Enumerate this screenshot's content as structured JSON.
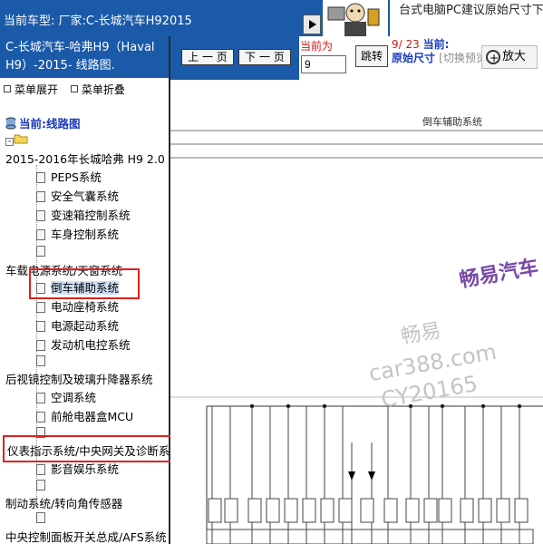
{
  "topbar": {
    "vehicle_label": "当前车型:  厂家:C-长城汽车H92015",
    "notice": "台式电脑PC建议原始尺寸下"
  },
  "sidebar": {
    "title": "C-长城汽车-哈弗H9（Haval H9）-2015- 线路图.",
    "menu_expand": "菜单展开",
    "menu_collapse": "菜单折叠",
    "current": "当前:线路图",
    "root": "2015-2016年长城哈弗 H9 2.0",
    "items": [
      "PEPS系统",
      "安全气囊系统",
      "变速箱控制系统",
      "车身控制系统",
      "",
      "车载电源系统/天窗系统",
      "倒车辅助系统",
      "电动座椅系统",
      "电源起动系统",
      "发动机电控系统",
      "",
      "后视镜控制及玻璃升降器系统",
      "空调系统",
      "前舱电器盒MCU",
      "",
      "仪表指示系统/中央网关及诊断系",
      "影音娱乐系统",
      "",
      "制动系统/转向角传感器",
      "",
      "中央控制面板开关总成/AFS系统"
    ]
  },
  "toolbar": {
    "prev": "上 一 页",
    "next": "下 一 页",
    "current_label": "当前为",
    "page_value": "9",
    "jump": "跳转",
    "page_info": "9/ 23",
    "current_mode_prefix": "当前:",
    "current_mode": "原始尺寸",
    "switch_hint": "[切换预览尺寸]",
    "zoom": "放大"
  },
  "diagram": {
    "title": "倒车辅助系统",
    "watermark_brand": "畅易汽车",
    "watermark_cn": "畅易",
    "watermark_url": "car388.com",
    "watermark_id": "CY20165"
  },
  "colors": {
    "brand_blue": "#1a5aa8",
    "highlight_red": "#e02020"
  }
}
